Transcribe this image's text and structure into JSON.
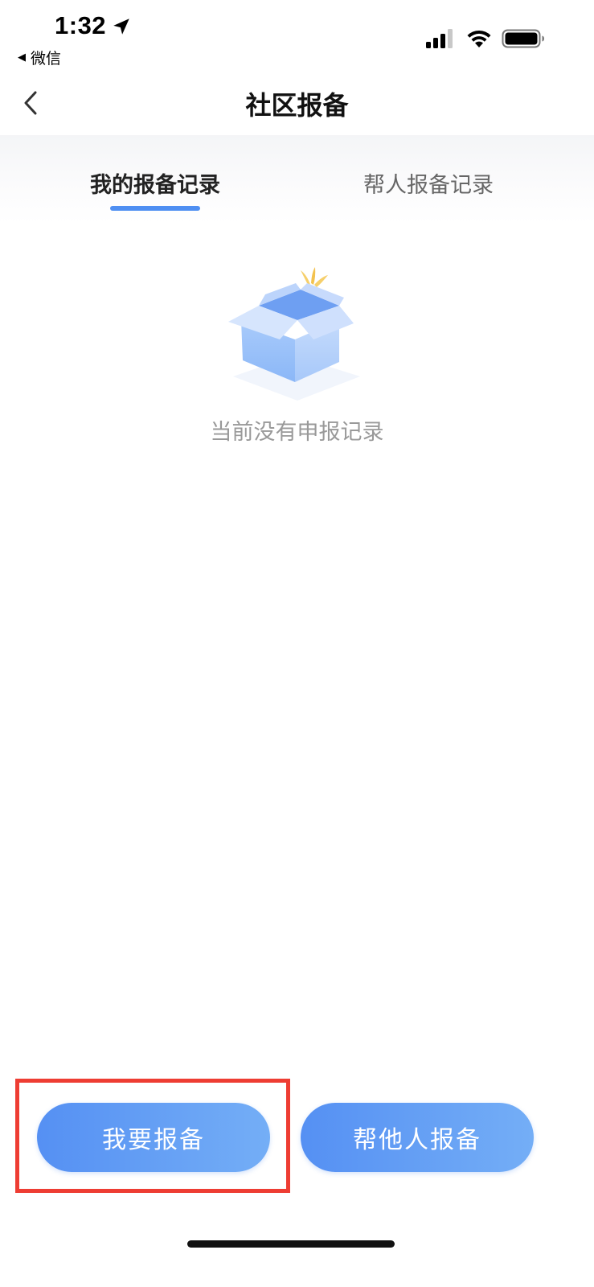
{
  "status_bar": {
    "time": "1:32",
    "back_app_label": "微信",
    "icons": [
      "location-arrow-icon",
      "signal-icon",
      "wifi-icon",
      "battery-icon"
    ]
  },
  "nav": {
    "title": "社区报备",
    "back_icon": "chevron-left-icon"
  },
  "tabs": [
    {
      "label": "我的报备记录",
      "active": true
    },
    {
      "label": "帮人报备记录",
      "active": false
    }
  ],
  "empty_state": {
    "icon": "empty-box-icon",
    "text": "当前没有申报记录"
  },
  "actions": {
    "self_report_label": "我要报备",
    "others_report_label": "帮他人报备"
  },
  "colors": {
    "accent": "#4f8ff2",
    "button_gradient_start": "#5590f3",
    "button_gradient_end": "#74aef6",
    "highlight": "#ee3d33"
  }
}
